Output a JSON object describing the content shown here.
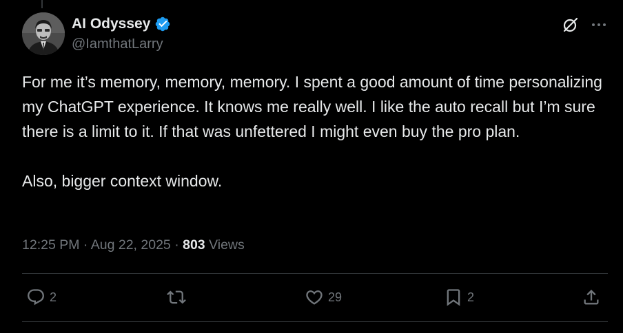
{
  "author": {
    "display_name": "AI Odyssey",
    "handle": "@IamthatLarry",
    "verified": true,
    "verified_color": "#1d9bf0"
  },
  "tweet": {
    "paragraphs": [
      "For me it’s memory, memory, memory. I spent a good amount of time personalizing my ChatGPT experience. It knows me really well. I like the auto recall but I’m sure there is a limit to it. If that was unfettered I might even buy the pro plan.",
      "Also, bigger context window."
    ],
    "time": "12:25 PM",
    "separator": "·",
    "date": "Aug 22, 2025",
    "views_count": "803",
    "views_label": "Views"
  },
  "actions": {
    "reply_count": "2",
    "retweet_count": "",
    "like_count": "29",
    "bookmark_count": "2"
  },
  "icons": {
    "reply": "reply-icon",
    "retweet": "retweet-icon",
    "like": "heart-icon",
    "bookmark": "bookmark-icon",
    "share": "share-icon",
    "grok": "grok-icon",
    "more": "more-icon"
  },
  "colors": {
    "background": "#000000",
    "text_primary": "#e7e9ea",
    "text_secondary": "#71767b",
    "divider": "#2f3336"
  }
}
